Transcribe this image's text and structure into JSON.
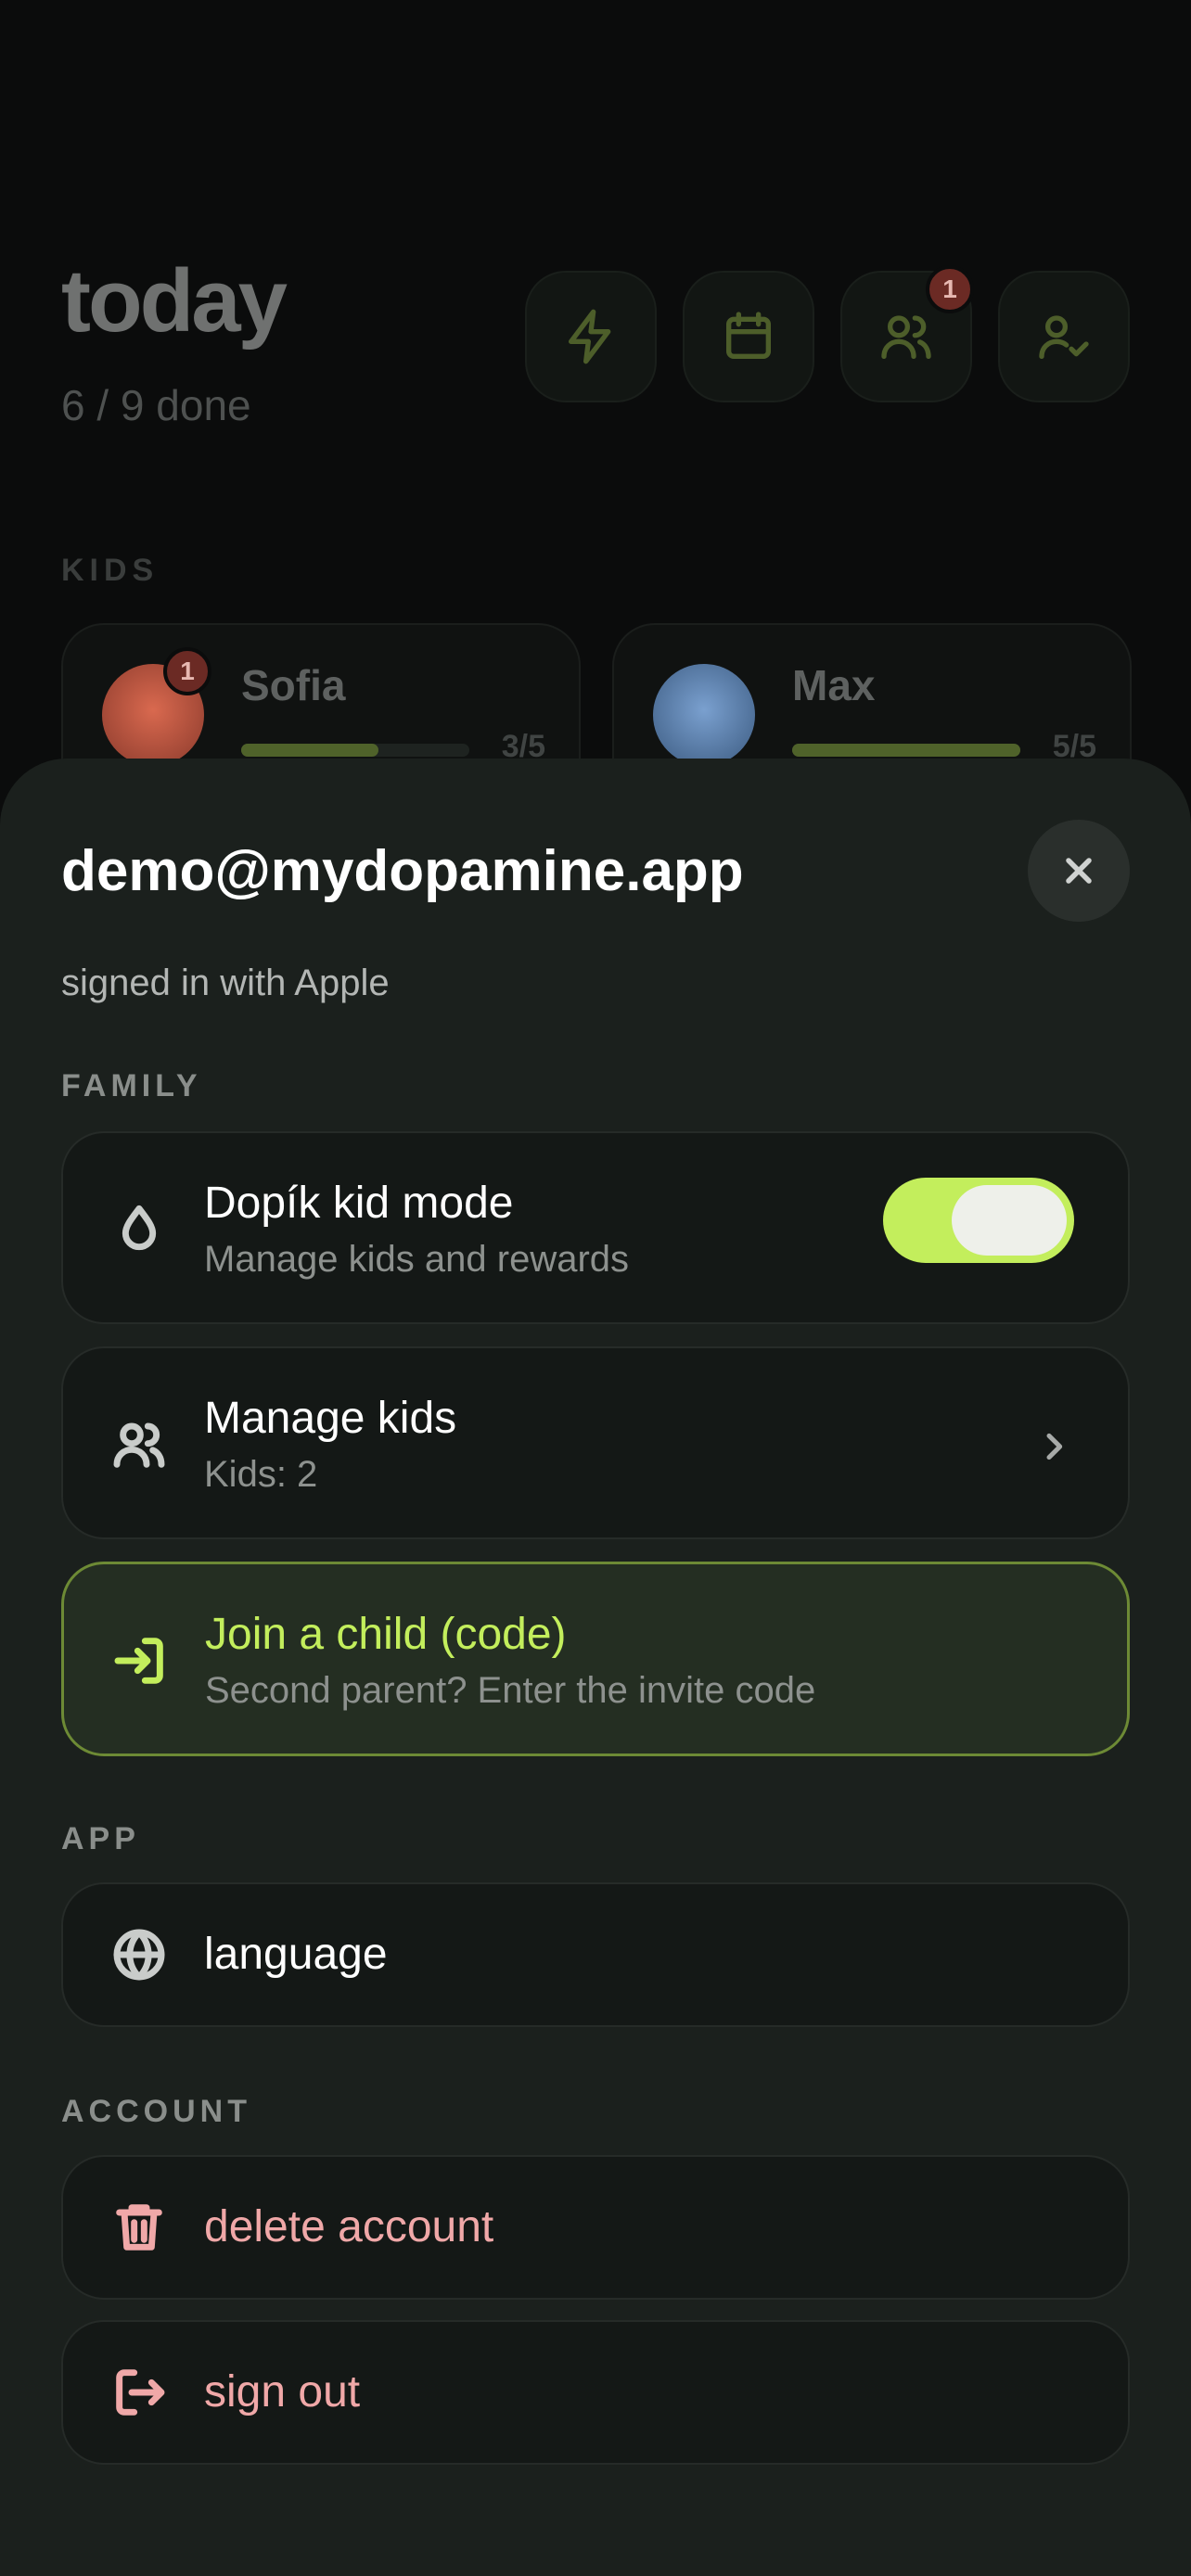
{
  "background": {
    "title": "today",
    "progress_text": "6 / 9 done",
    "header_buttons": [
      {
        "icon": "lightning-icon"
      },
      {
        "icon": "calendar-icon"
      },
      {
        "icon": "users-icon",
        "badge": "1"
      },
      {
        "icon": "user-check-icon"
      }
    ],
    "kids_label": "KIDS",
    "kids": [
      {
        "name": "Sofia",
        "count": "3/5",
        "progress": 0.6,
        "badge": "1",
        "avatar_color": "#b5533f"
      },
      {
        "name": "Max",
        "count": "5/5",
        "progress": 1.0,
        "avatar_color": "#4b6e99"
      }
    ]
  },
  "sheet": {
    "email": "demo@mydopamine.app",
    "signed_in_text": "signed in with Apple",
    "family_label": "FAMILY",
    "kid_mode": {
      "title": "Dopík kid mode",
      "subtitle": "Manage kids and rewards",
      "enabled": true
    },
    "manage_kids": {
      "title": "Manage kids",
      "subtitle": "Kids: 2"
    },
    "join_child": {
      "title": "Join a child (code)",
      "subtitle": "Second parent? Enter the invite code"
    },
    "app_label": "APP",
    "language": {
      "title": "language"
    },
    "account_label": "ACCOUNT",
    "delete_account": {
      "title": "delete account"
    },
    "sign_out": {
      "title": "sign out"
    }
  },
  "colors": {
    "accent": "#c3ee5c",
    "danger_text": "#f0a8a8",
    "sheet_bg": "#1b201d"
  }
}
